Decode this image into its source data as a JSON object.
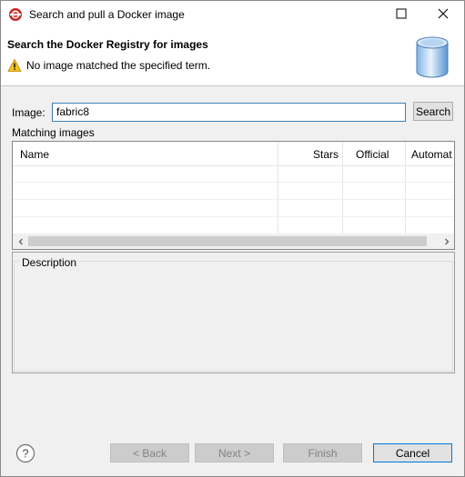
{
  "window": {
    "title": "Search and pull a Docker image"
  },
  "banner": {
    "title": "Search the Docker Registry for images",
    "message": "No image matched the specified term."
  },
  "image": {
    "label": "Image:",
    "value": "fabric8",
    "search_label": "Search"
  },
  "matching": {
    "label": "Matching images",
    "columns": [
      "Name",
      "Stars",
      "Official",
      "Automat"
    ],
    "rows": []
  },
  "description": {
    "label": "Description"
  },
  "footer": {
    "back_label": "< Back",
    "next_label": "Next >",
    "finish_label": "Finish",
    "cancel_label": "Cancel"
  },
  "icons": {
    "app": "eclipse-docker-icon",
    "warning": "warning-icon",
    "database": "database-icon",
    "help": "help-icon"
  },
  "colors": {
    "input_focus_border": "#3c7fb1",
    "default_button_border": "#0078d7",
    "warning": "#f5c518"
  }
}
